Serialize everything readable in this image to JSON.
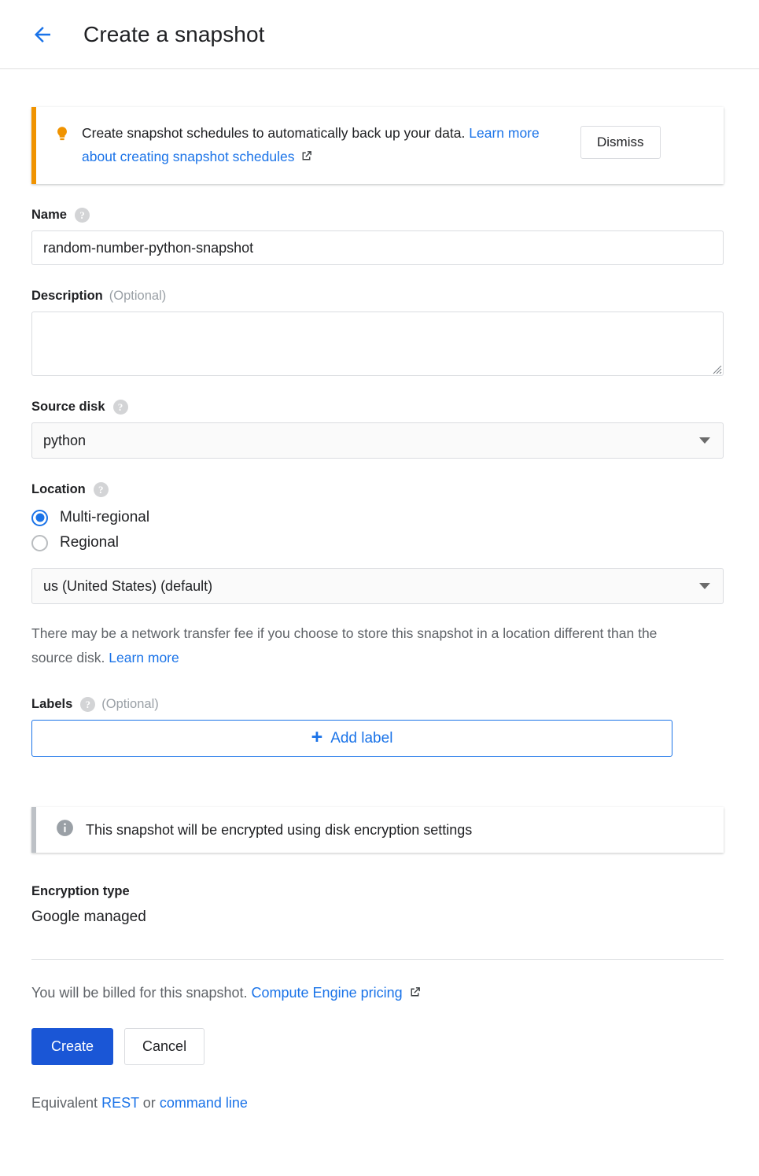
{
  "header": {
    "back_icon": "arrow-left-icon",
    "title": "Create a snapshot"
  },
  "promo_banner": {
    "icon": "lightbulb-icon",
    "text_part1": "Create snapshot schedules to automatically back up your data.",
    "link_text": "Learn more about creating snapshot schedules",
    "external_icon": "external-link-icon",
    "dismiss_label": "Dismiss",
    "accent_color": "#f09300"
  },
  "name_field": {
    "label": "Name",
    "help_icon": "help-icon",
    "value": "random-number-python-snapshot",
    "placeholder": ""
  },
  "description_field": {
    "label": "Description",
    "optional": "(Optional)",
    "value": "",
    "placeholder": ""
  },
  "source_disk_field": {
    "label": "Source disk",
    "help_icon": "help-icon",
    "value": "python",
    "dropdown_icon": "chevron-down-icon"
  },
  "location_field": {
    "label": "Location",
    "help_icon": "help-icon",
    "options": [
      {
        "label": "Multi-regional",
        "selected": true
      },
      {
        "label": "Regional",
        "selected": false
      }
    ],
    "region_value": "us (United States) (default)",
    "dropdown_icon": "chevron-down-icon",
    "note_text": "There may be a network transfer fee if you choose to store this snapshot in a location different than the source disk.",
    "note_link": "Learn more"
  },
  "labels_field": {
    "label": "Labels",
    "optional": "(Optional)",
    "add_button_label": "Add label",
    "plus_icon": "plus-icon",
    "accent_color": "#1a73e8"
  },
  "encryption_banner": {
    "icon": "info-icon",
    "text": "This snapshot will be encrypted using disk encryption settings",
    "accent_color": "#bdc1c6"
  },
  "encryption": {
    "title": "Encryption type",
    "value": "Google managed"
  },
  "billing": {
    "text": "You will be billed for this snapshot.",
    "link_text": "Compute Engine pricing",
    "external_icon": "external-link-icon"
  },
  "actions": {
    "create_label": "Create",
    "cancel_label": "Cancel",
    "primary_color": "#1a56d6"
  },
  "footer": {
    "prefix": "Equivalent",
    "rest_link": "REST",
    "separator": "or",
    "cli_link": "command line"
  }
}
